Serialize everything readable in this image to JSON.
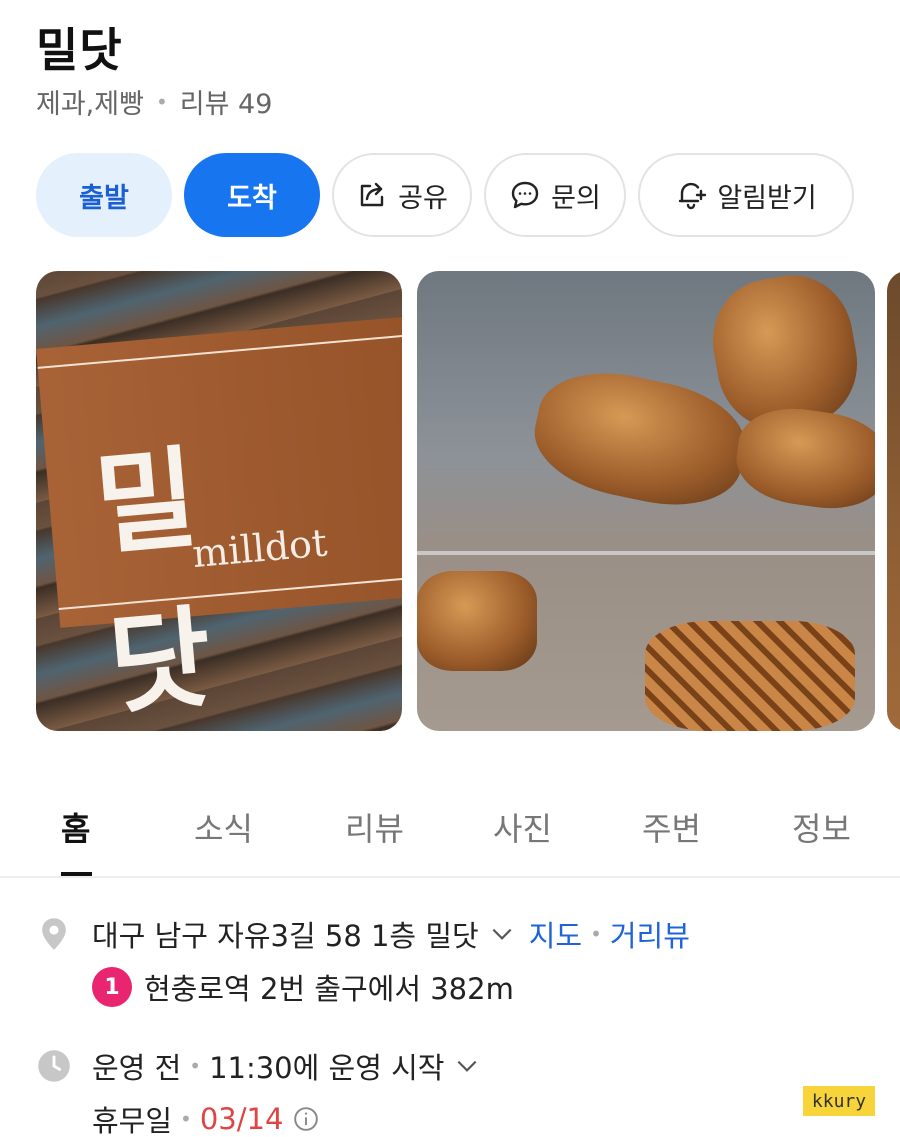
{
  "place": {
    "name": "밀닷",
    "category": "제과,제빵",
    "review_label": "리뷰 49"
  },
  "actions": {
    "depart": "출발",
    "arrive": "도착",
    "share": "공유",
    "inquiry": "문의",
    "notify": "알림받기"
  },
  "photos": {
    "sign_korean": "밀 닷",
    "sign_english": "milldot"
  },
  "tabs": [
    "홈",
    "소식",
    "리뷰",
    "사진",
    "주변",
    "정보"
  ],
  "active_tab": "홈",
  "address": {
    "text": "대구 남구 자유3길 58 1층 밀닷",
    "map_link": "지도",
    "street_view_link": "거리뷰"
  },
  "transit": {
    "line_badge": "1",
    "text": "현충로역 2번 출구에서 382m"
  },
  "hours": {
    "status": "운영 전",
    "detail": "11:30에 운영 시작",
    "holiday_label": "휴무일",
    "holiday_date": "03/14"
  },
  "watermark": "kkury",
  "colors": {
    "primary": "#1875f0",
    "primary_light": "#e5f0fd",
    "link": "#1f63d8",
    "holiday": "#e04545",
    "badge": "#e8256e"
  },
  "icons": {
    "share": "share-icon",
    "inquiry": "chat-bubble-icon",
    "notify": "bell-plus-icon",
    "address": "map-pin-icon",
    "hours": "clock-icon",
    "info": "info-icon"
  }
}
